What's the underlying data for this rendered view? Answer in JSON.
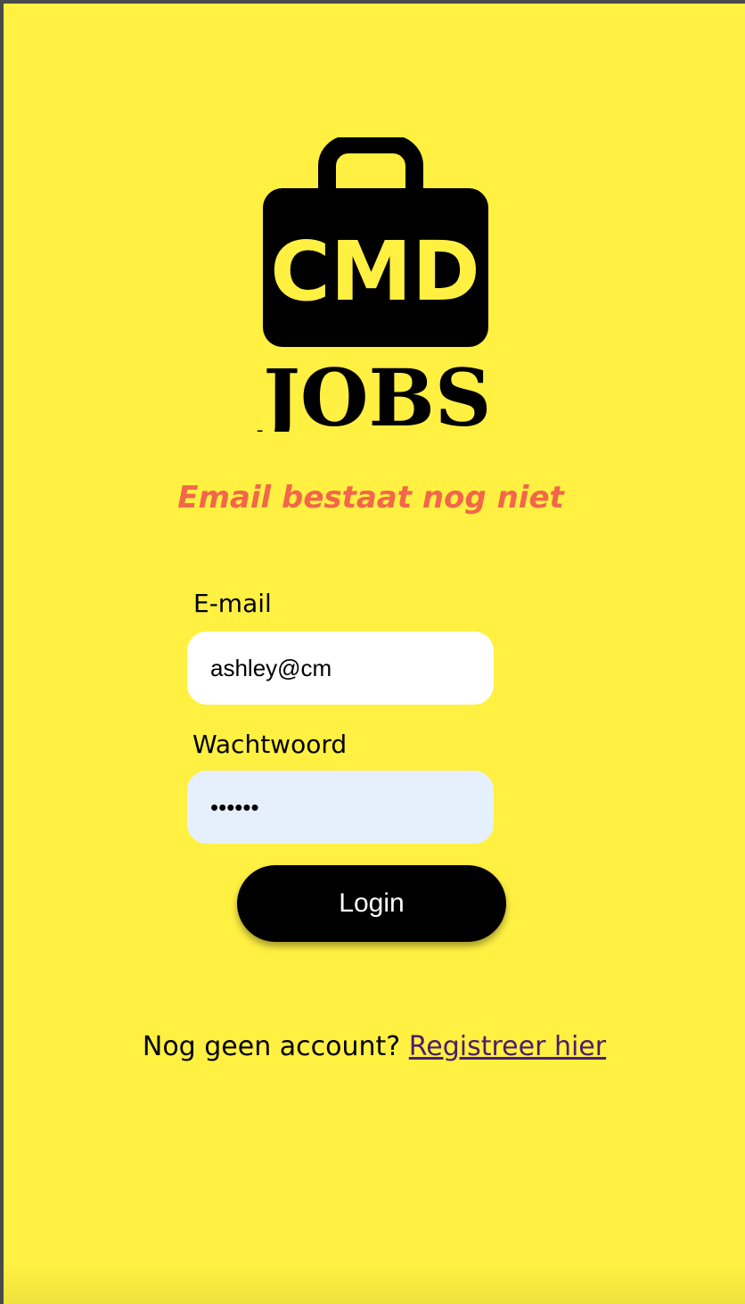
{
  "logo": {
    "line1": "CMD",
    "line2": ".JOBS",
    "icon": "briefcase-icon"
  },
  "error_message": "Email bestaat nog niet",
  "form": {
    "email_label": "E-mail",
    "email_value": "ashley@cm",
    "password_label": "Wachtwoord",
    "password_value": "••••••",
    "login_label": "Login"
  },
  "register": {
    "prompt": "Nog geen account?",
    "link_label": "Registreer hier"
  },
  "colors": {
    "background": "#fff042",
    "error": "#f2664a",
    "button": "#000000",
    "link": "#4a1e6b",
    "password_field": "#e6f0fc"
  }
}
